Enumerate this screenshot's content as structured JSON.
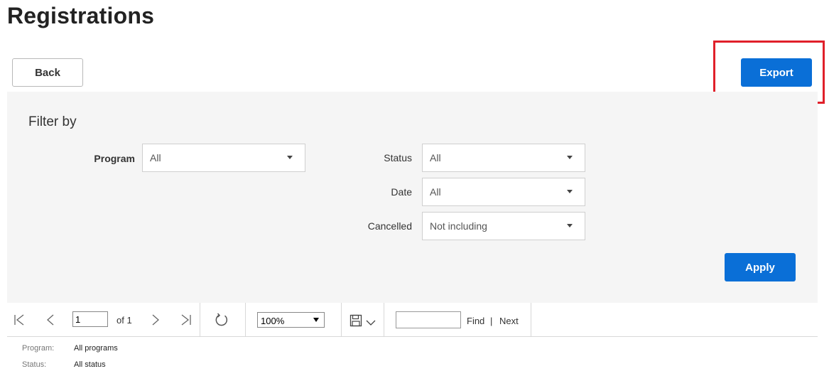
{
  "page": {
    "title": "Registrations"
  },
  "actions": {
    "back_label": "Back",
    "export_label": "Export"
  },
  "filters": {
    "heading": "Filter by",
    "program": {
      "label": "Program",
      "value": "All"
    },
    "status": {
      "label": "Status",
      "value": "All"
    },
    "date": {
      "label": "Date",
      "value": "All"
    },
    "cancelled": {
      "label": "Cancelled",
      "value": "Not including"
    },
    "apply_label": "Apply"
  },
  "toolbar": {
    "page_value": "1",
    "of_text": "of 1",
    "zoom_value": "100%",
    "find_label": "Find",
    "separator": "|",
    "next_label": "Next",
    "icons": [
      "first-page-icon",
      "previous-page-icon",
      "next-page-icon",
      "last-page-icon",
      "refresh-icon",
      "save-icon",
      "chevron-down-icon"
    ]
  },
  "report": {
    "program_label": "Program:",
    "program_value": "All programs",
    "status_label": "Status:",
    "status_value": "All status"
  },
  "colors": {
    "accent": "#0a6fd7",
    "highlight": "#e0202a",
    "panel_bg": "#f5f5f5"
  }
}
